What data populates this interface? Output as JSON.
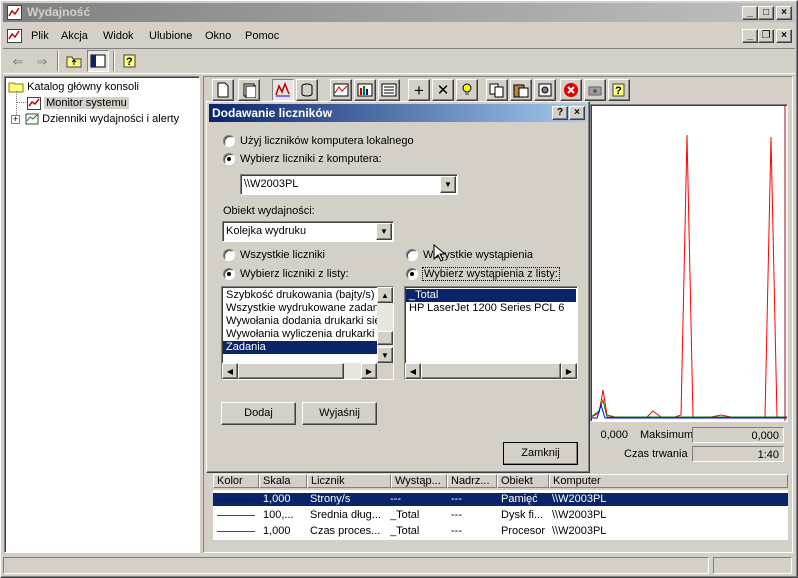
{
  "window": {
    "title": "Wydajność"
  },
  "menu": [
    {
      "label": "Plik",
      "name": "menu-plik"
    },
    {
      "label": "Akcja",
      "name": "menu-akcja"
    },
    {
      "label": "Widok",
      "name": "menu-widok"
    },
    {
      "label": "Ulubione",
      "name": "menu-ulubione"
    },
    {
      "label": "Okno",
      "name": "menu-okno"
    },
    {
      "label": "Pomoc",
      "name": "menu-pomoc"
    }
  ],
  "tree": {
    "root": "Katalog główny konsoli",
    "monitor": "Monitor systemu",
    "logs": "Dzienniki wydajności i alerty"
  },
  "dialog": {
    "title": "Dodawanie liczników",
    "help_glyph": "?",
    "close_glyph": "×",
    "radio_local": "Użyj liczników komputera lokalnego",
    "radio_select_computer": "Wybierz liczniki z komputera:",
    "computer_value": "\\\\W2003PL",
    "object_label": "Obiekt wydajności:",
    "object_value": "Kolejka wydruku",
    "all_counters": "Wszystkie liczniki",
    "select_counters": "Wybierz liczniki z listy:",
    "all_instances": "Wszystkie wystąpienia",
    "select_instances": "Wybierz wystąpienia z listy:",
    "counters": [
      "Szybkość drukowania (bajty/s)",
      "Wszystkie wydrukowane zadania",
      "Wywołania dodania drukarki sieci",
      "Wywołania wyliczenia drukarki sie",
      "Zadania"
    ],
    "instances": [
      "_Total",
      "HP LaserJet 1200 Series PCL 6"
    ],
    "add_button": "Dodaj",
    "explain_button": "Wyjaśnij",
    "close_button": "Zamknij"
  },
  "stats": {
    "min_value": "0,000",
    "max_label": "Maksimum",
    "max_value": "0,000",
    "duration_label": "Czas trwania",
    "duration_value": "1:40"
  },
  "counter_table": {
    "headers": [
      "Kolor",
      "Skala",
      "Licznik",
      "Wystąp...",
      "Nadrz...",
      "Obiekt",
      "Komputer"
    ],
    "rows": [
      {
        "color": "#0000ff",
        "scale": "1,000",
        "counter": "Strony/s",
        "instance": "---",
        "parent": "---",
        "object": "Pamięć",
        "computer": "\\\\W2003PL"
      },
      {
        "color": "#008000",
        "scale": "100,...",
        "counter": "Średnia dług...",
        "instance": "_Total",
        "parent": "---",
        "object": "Dysk fi...",
        "computer": "\\\\W2003PL"
      },
      {
        "color": "#ff0000",
        "scale": "1,000",
        "counter": "Czas proces...",
        "instance": "_Total",
        "parent": "---",
        "object": "Procesor",
        "computer": "\\\\W2003PL"
      }
    ]
  },
  "colors": {
    "selection": "#0a246a",
    "graph_red": "#ff0000",
    "graph_blue": "#0000ff",
    "graph_green": "#008000"
  }
}
